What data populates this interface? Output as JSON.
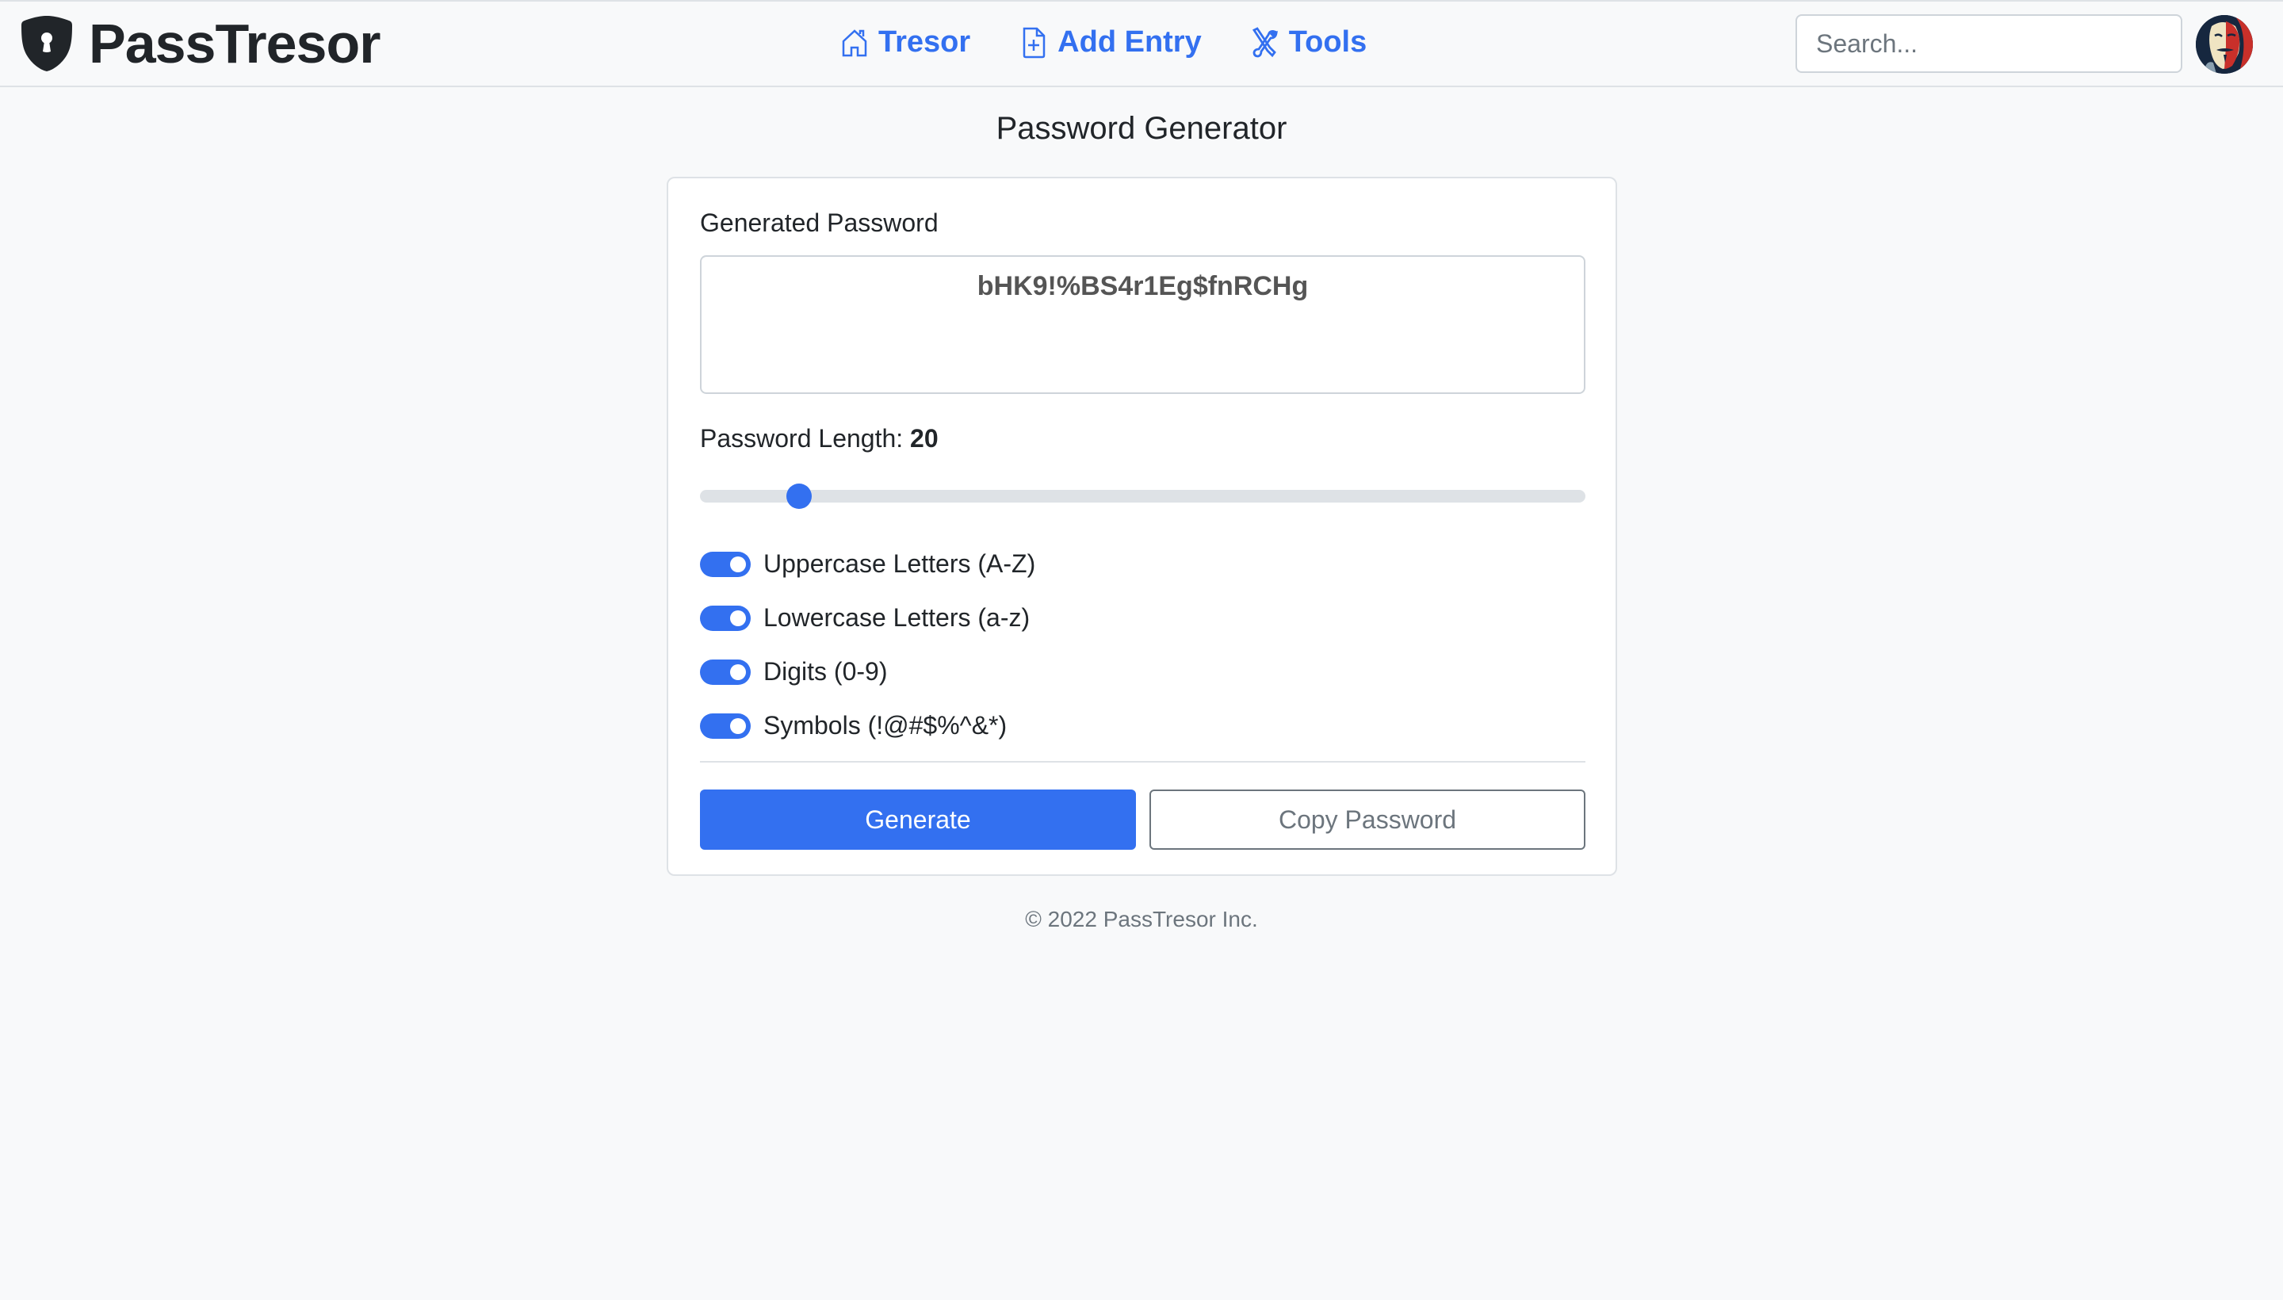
{
  "header": {
    "brand": "PassTresor",
    "logo_icon": "shield-keyhole-icon",
    "nav": [
      {
        "label": "Tresor",
        "icon": "house-icon"
      },
      {
        "label": "Add Entry",
        "icon": "file-plus-icon"
      },
      {
        "label": "Tools",
        "icon": "tools-icon"
      }
    ],
    "search_placeholder": "Search...",
    "search_value": "",
    "avatar": "user-avatar"
  },
  "page": {
    "title": "Password Generator"
  },
  "generator": {
    "generated_label": "Generated Password",
    "password": "bHK9!%BS4r1Eg$fnRCHg",
    "length_label": "Password Length:",
    "length_value": "20",
    "length_slider": {
      "value": 20,
      "min": 8,
      "max": 128
    },
    "options": [
      {
        "label": "Uppercase Letters (A-Z)",
        "checked": true
      },
      {
        "label": "Lowercase Letters (a-z)",
        "checked": true
      },
      {
        "label": "Digits (0-9)",
        "checked": true
      },
      {
        "label": "Symbols (!@#$%^&*)",
        "checked": true
      }
    ],
    "generate_label": "Generate",
    "copy_label": "Copy Password"
  },
  "footer": {
    "text": "© 2022 PassTresor Inc."
  },
  "colors": {
    "accent": "#3370f0",
    "background": "#f8f9fa",
    "text": "#212529",
    "muted": "#6c757d"
  }
}
